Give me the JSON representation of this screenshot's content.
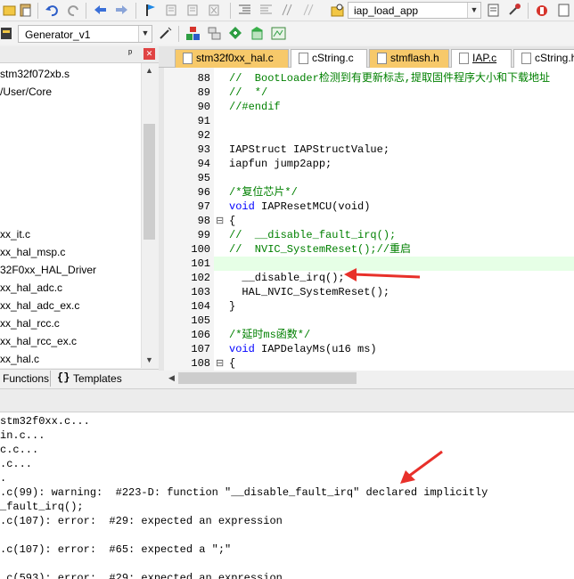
{
  "toolbar": {
    "target_name": "iap_load_app",
    "config_name": "Generator_v1",
    "icons": [
      "paste-icon",
      "undo-icon",
      "redo-icon",
      "nav-back-icon",
      "nav-forward-icon",
      "bookmark-icon",
      "bookmark-prev-icon",
      "bookmark-next-icon",
      "bookmark-clear-icon",
      "indent-icon",
      "unindent-icon",
      "comment-icon",
      "uncomment-icon",
      "find-in-files-icon",
      "target-options-icon",
      "manage-components-icon",
      "debug-icon",
      "wizard-icon",
      "pack-installer-icon",
      "select-packs-icon",
      "run-env-icon",
      "manage-run-icon"
    ]
  },
  "project": {
    "pin_label": "ᵖ",
    "close_label": "✕",
    "tree": [
      "stm32f072xb.s",
      "/User/Core",
      "",
      "",
      "",
      "",
      "",
      "",
      "",
      "xx_it.c",
      "xx_hal_msp.c",
      "32F0xx_HAL_Driver",
      "xx_hal_adc.c",
      "xx_hal_adc_ex.c",
      "xx_hal_rcc.c",
      "xx_hal_rcc_ex.c",
      "xx_hal.c"
    ],
    "bottom_tabs": {
      "functions": "Functions",
      "templates_prefix": "{}",
      "templates": "Templates"
    }
  },
  "editor": {
    "tabs": [
      {
        "label": "stm32f0xx_hal.c",
        "active": false,
        "color": "#f7c96a"
      },
      {
        "label": "cString.c",
        "active": false,
        "color": "#ffffff"
      },
      {
        "label": "stmflash.h",
        "active": false,
        "color": "#f7c96a"
      },
      {
        "label": "IAP.c",
        "active": true,
        "color": "#f7c96a"
      },
      {
        "label": "cString.h",
        "active": false,
        "color": "#ffffff"
      }
    ],
    "lines": [
      {
        "n": "88",
        "text": "//  BootLoader检测到有更新标志,提取固件程序大小和下载地址",
        "cls": "cm"
      },
      {
        "n": "89",
        "text": "//  */",
        "cls": "cm"
      },
      {
        "n": "90",
        "text": "//#endif",
        "cls": "cm"
      },
      {
        "n": "91",
        "text": "",
        "cls": ""
      },
      {
        "n": "92",
        "text": "",
        "cls": ""
      },
      {
        "n": "93",
        "text": "IAPStruct IAPStructValue;",
        "cls": ""
      },
      {
        "n": "94",
        "text": "iapfun jump2app;",
        "cls": ""
      },
      {
        "n": "95",
        "text": "",
        "cls": ""
      },
      {
        "n": "96",
        "text": "/*复位芯片*/",
        "cls": "cm"
      },
      {
        "n": "97",
        "text": "void IAPResetMCU(void)",
        "cls": "void"
      },
      {
        "n": "98",
        "text": "{",
        "cls": "",
        "fold": "⊟"
      },
      {
        "n": "99",
        "text": "//  __disable_fault_irq();",
        "cls": "cm"
      },
      {
        "n": "100",
        "text": "//  NVIC_SystemReset();//重启",
        "cls": "cm"
      },
      {
        "n": "101",
        "text": "",
        "cls": "",
        "highlight": true
      },
      {
        "n": "102",
        "text": "  __disable_irq();",
        "cls": ""
      },
      {
        "n": "103",
        "text": "  HAL_NVIC_SystemReset();",
        "cls": ""
      },
      {
        "n": "104",
        "text": "}",
        "cls": ""
      },
      {
        "n": "105",
        "text": "",
        "cls": ""
      },
      {
        "n": "106",
        "text": "/*延时ms函数*/",
        "cls": "cm"
      },
      {
        "n": "107",
        "text": "void IAPDelayMs(u16 ms)",
        "cls": "void"
      },
      {
        "n": "108",
        "text": "{",
        "cls": "",
        "fold": "⊟"
      }
    ]
  },
  "build_output": {
    "lines": [
      "stm32f0xx.c...",
      "in.c...",
      "c.c...",
      ".c...",
      ".",
      ".c(99): warning:  #223-D: function \"__disable_fault_irq\" declared implicitly",
      "_fault_irq();",
      ".c(107): error:  #29: expected an expression",
      "",
      ".c(107): error:  #65: expected a \";\"",
      "",
      ".c(593): error:  #29: expected an expression"
    ]
  },
  "annotations": {
    "arrow_color": "#e8302a"
  }
}
